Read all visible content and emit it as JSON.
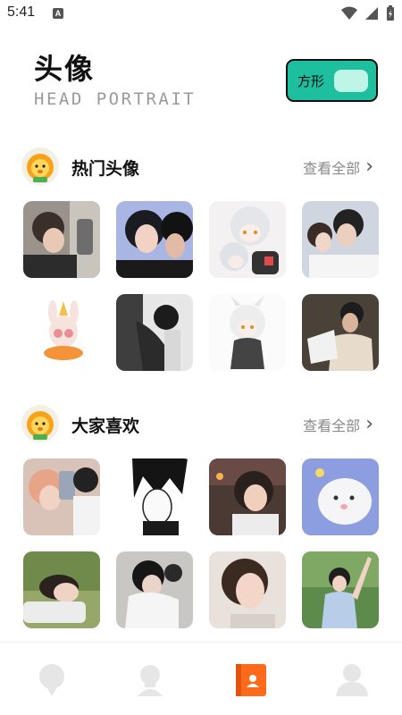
{
  "status": {
    "time": "5:41",
    "badge": "A"
  },
  "header": {
    "title": "头像",
    "subtitle": "HEAD PORTRAIT"
  },
  "shape_toggle": {
    "label": "方形"
  },
  "sections": [
    {
      "title": "热门头像",
      "more": "查看全部"
    },
    {
      "title": "大家喜欢",
      "more": "查看全部"
    }
  ],
  "chevron": "›",
  "colors": {
    "accent": "#1dbf9f",
    "knob": "#bff5e6",
    "active_tab": "#ff6a1a",
    "inactive_tab": "#e6e6e6"
  },
  "tabs": [
    {
      "icon": "ice-cream-icon",
      "active": false
    },
    {
      "icon": "bust-icon",
      "active": false
    },
    {
      "icon": "avatar-card-icon",
      "active": true
    },
    {
      "icon": "person-icon",
      "active": false
    }
  ]
}
